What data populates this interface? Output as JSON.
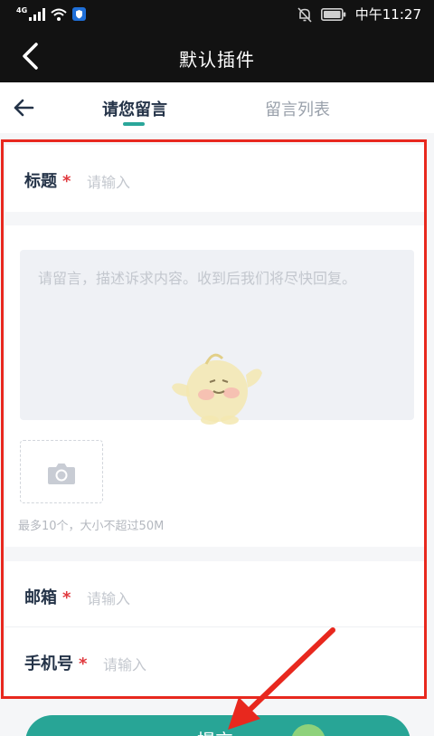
{
  "status_bar": {
    "network": "4G",
    "time": "中午11:27",
    "icons": [
      "signal-icon",
      "wifi-icon",
      "shield-app-icon",
      "mute-bell-icon",
      "battery-icon"
    ]
  },
  "titlebar": {
    "title": "默认插件"
  },
  "tabs": [
    {
      "label": "请您留言",
      "active": true
    },
    {
      "label": "留言列表",
      "active": false
    }
  ],
  "form": {
    "title_field": {
      "label": "标题",
      "required_mark": "*",
      "placeholder": "请输入"
    },
    "message_field": {
      "placeholder": "请留言，描述诉求内容。收到后我们将尽快回复。"
    },
    "upload": {
      "hint": "最多10个，大小不超过50M"
    },
    "email_field": {
      "label": "邮箱",
      "required_mark": "*",
      "placeholder": "请输入"
    },
    "phone_field": {
      "label": "手机号",
      "required_mark": "*",
      "placeholder": "请输入"
    }
  },
  "submit": {
    "label": "提交"
  },
  "colors": {
    "accent": "#28a596",
    "highlight_box": "#e8281e",
    "header_bg": "#121212"
  }
}
